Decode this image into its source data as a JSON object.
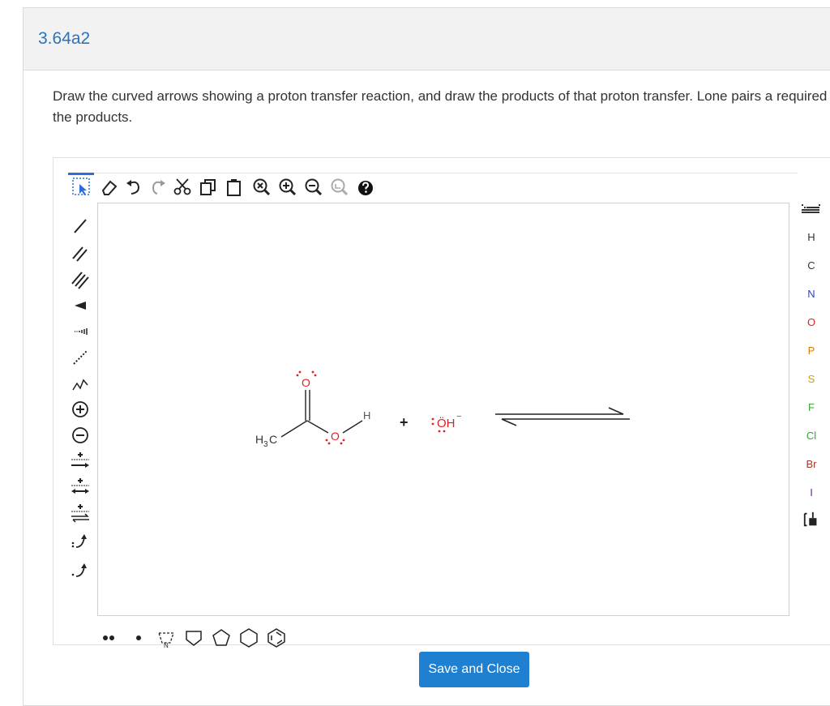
{
  "header": {
    "title": "3.64a2"
  },
  "question": {
    "text": "Draw the curved arrows showing a proton transfer reaction, and draw the products of that proton transfer. Lone pairs a required in the products."
  },
  "molecule": {
    "ch3_H": "H",
    "ch3_3": "3",
    "ch3_C": "C",
    "carbonyl_O": "O",
    "hydroxyl_O": "O",
    "acid_H": "H",
    "plus": "+",
    "hydroxide": "ÖH",
    "hydroxide_charge": "−"
  },
  "right_toolbar": {
    "elements": [
      "H",
      "C",
      "N",
      "O",
      "P",
      "S",
      "F",
      "Cl",
      "Br",
      "I"
    ],
    "element_colors": [
      "#333333",
      "#333333",
      "#2b3fd6",
      "#e02020",
      "#d97a00",
      "#c8a400",
      "#3aa83a",
      "#2ea82e",
      "#a4362a",
      "#7a1fa2"
    ]
  },
  "footer": {
    "save_label": "Save and Close"
  }
}
